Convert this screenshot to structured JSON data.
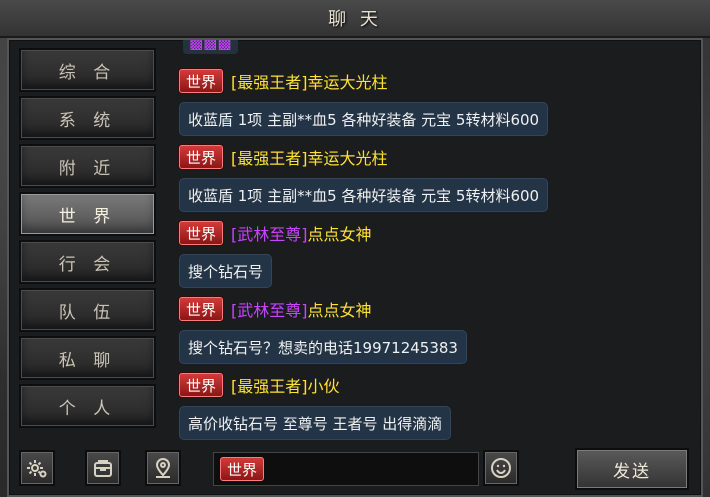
{
  "window": {
    "title": "聊 天"
  },
  "tabs": [
    {
      "label": "综 合",
      "active": false
    },
    {
      "label": "系 统",
      "active": false
    },
    {
      "label": "附 近",
      "active": false
    },
    {
      "label": "世 界",
      "active": true
    },
    {
      "label": "行 会",
      "active": false
    },
    {
      "label": "队 伍",
      "active": false
    },
    {
      "label": "私 聊",
      "active": false
    },
    {
      "label": "个 人",
      "active": false
    }
  ],
  "messages": [
    {
      "channel": "世界",
      "title": "[最强王者]",
      "title_color": "yellow",
      "name": "幸运大光柱",
      "text": "收蓝盾 1项 主副**血5 各种好装备 元宝 5转材料600"
    },
    {
      "channel": "世界",
      "title": "[最强王者]",
      "title_color": "yellow",
      "name": "幸运大光柱",
      "text": "收蓝盾 1项 主副**血5 各种好装备 元宝 5转材料600"
    },
    {
      "channel": "世界",
      "title": "[武林至尊]",
      "title_color": "purple",
      "name": "点点女神",
      "text": "搜个钻石号"
    },
    {
      "channel": "世界",
      "title": "[武林至尊]",
      "title_color": "purple",
      "name": "点点女神",
      "text": "搜个钻石号？想卖的电话19971245383"
    },
    {
      "channel": "世界",
      "title": "[最强王者]",
      "title_color": "yellow",
      "name": "小伙",
      "text": "高价收钻石号 至尊号 王者号 出得滴滴"
    }
  ],
  "input": {
    "channel": "世界",
    "value": ""
  },
  "toolbar": {
    "send_label": "发送"
  },
  "icons": {
    "settings": "gear-icon",
    "bag": "bag-icon",
    "location": "location-icon",
    "emoji": "smile-icon"
  },
  "colors": {
    "badge_red": "#c42a2a",
    "title_yellow": "#ffe033",
    "title_purple": "#c844ff",
    "bubble": "#233446"
  }
}
